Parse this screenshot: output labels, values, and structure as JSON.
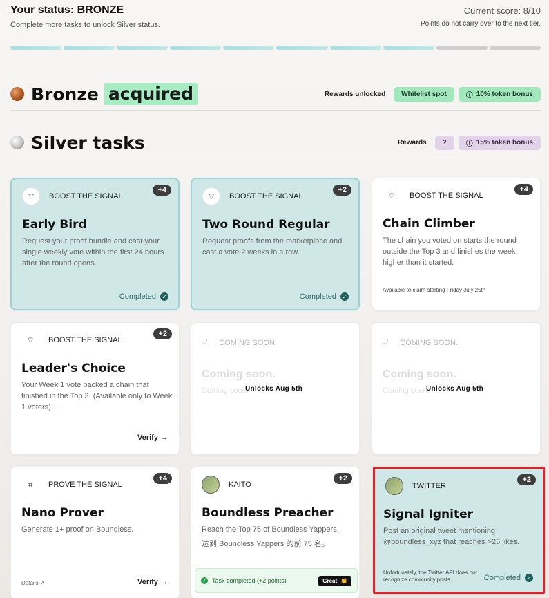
{
  "status": {
    "title": "Your status: BRONZE",
    "subtitle": "Complete more tasks to unlock Silver status.",
    "score": "Current score: 8/10",
    "note": "Points do not carry over to the next tier.",
    "progress_filled": 8,
    "progress_total": 10
  },
  "bronze": {
    "title": "Bronze",
    "acquired": "acquired",
    "rewards_label": "Rewards unlocked",
    "rewards": [
      "Whitelist spot",
      "10% token bonus"
    ]
  },
  "silver": {
    "title": "Silver tasks",
    "rewards_label": "Rewards",
    "rewards": [
      "?",
      "15% token bonus"
    ]
  },
  "cards": [
    {
      "category": "BOOST THE SIGNAL",
      "points": "+4",
      "title": "Early Bird",
      "desc": "Request your proof bundle and cast your single weekly vote within the first 24 hours after the round opens.",
      "status": "Completed"
    },
    {
      "category": "BOOST THE SIGNAL",
      "points": "+2",
      "title": "Two Round Regular",
      "desc": "Request proofs from the marketplace and cast a vote 2 weeks in a row.",
      "status": "Completed"
    },
    {
      "category": "BOOST THE SIGNAL",
      "points": "+4",
      "title": "Chain Climber",
      "desc": "The chain you voted on starts the round outside the Top 3 and finishes the week higher than it started.",
      "note": "Available to claim starting Friday July 25th"
    },
    {
      "category": "BOOST THE SIGNAL",
      "points": "+2",
      "title": "Leader's Choice",
      "desc": "Your Week 1 vote backed a chain that finished in the Top 3. (Available only to Week 1 voters)…",
      "action": "Verify"
    },
    {
      "category": "COMING SOON.",
      "title": "Coming soon.",
      "desc": "Coming soon.",
      "unlocks": "Unlocks Aug 5th"
    },
    {
      "category": "COMING SOON.",
      "title": "Coming soon.",
      "desc": "Coming soon.",
      "unlocks": "Unlocks Aug 5th"
    },
    {
      "category": "PROVE THE SIGNAL",
      "points": "+4",
      "title": "Nano Prover",
      "desc": "Generate 1+ proof on Boundless.",
      "details": "Details",
      "action": "Verify"
    },
    {
      "category": "KAITO",
      "points": "+2",
      "title": "Boundless Preacher",
      "desc": "Reach the Top 75 of Boundless Yappers.",
      "desc2": "达到 Boundless Yappers 的前 75 名。",
      "toast": "Task completed (+2 points)",
      "toast_btn": "Great! 👏"
    },
    {
      "category": "TWITTER",
      "points": "+2",
      "title": "Signal Igniter",
      "desc": "Post an original tweet mentioning @boundless_xyz that reaches >25 likes.",
      "note": "Unfortunately, the Twitter API does not recognize community posts.",
      "status": "Completed"
    }
  ]
}
